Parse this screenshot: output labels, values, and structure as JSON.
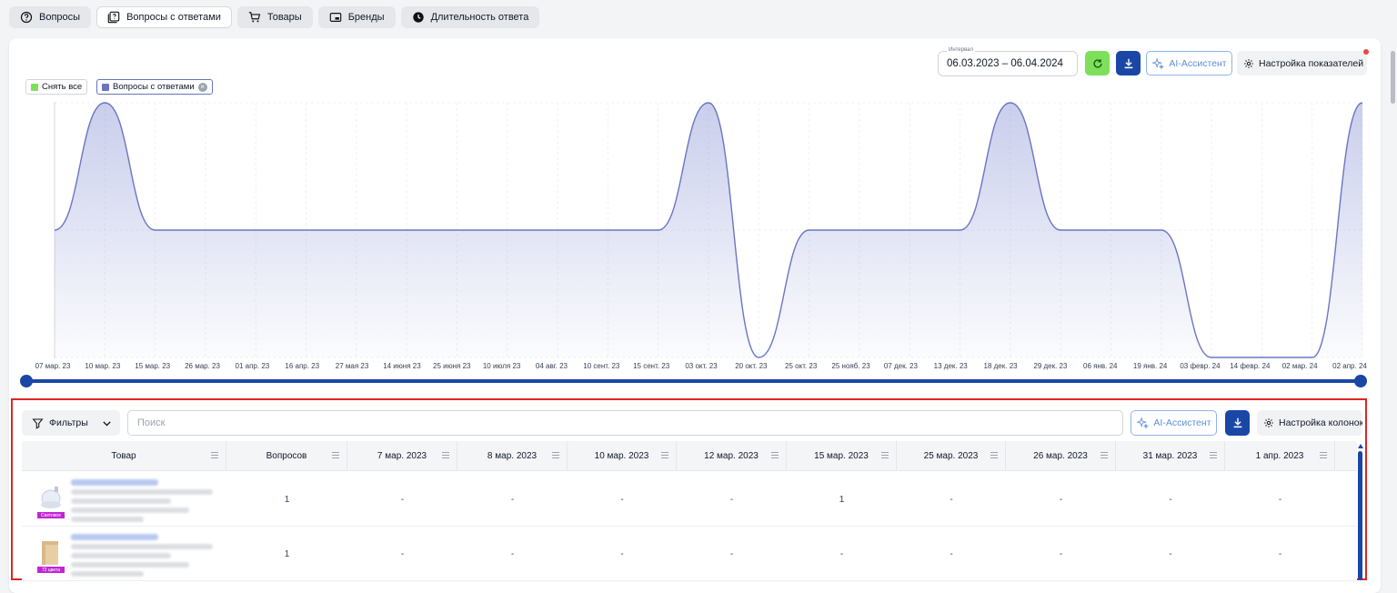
{
  "tabs": [
    {
      "label": "Вопросы",
      "icon": "question-circle-icon"
    },
    {
      "label": "Вопросы с ответами",
      "icon": "question-answer-icon",
      "active": true
    },
    {
      "label": "Товары",
      "icon": "cart-icon"
    },
    {
      "label": "Бренды",
      "icon": "brand-card-icon"
    },
    {
      "label": "Длительность ответа",
      "icon": "clock-icon"
    }
  ],
  "toolbar": {
    "interval_label": "Интервал",
    "interval_value": "06.03.2023 – 06.04.2024",
    "ai_label": "AI-Ассистент",
    "settings_label": "Настройка показателей"
  },
  "legend": {
    "clear_all": "Снять все",
    "series_chip": "Вопросы с ответами"
  },
  "colors": {
    "accent": "#1a47a6",
    "line": "#6a76c2",
    "refresh": "#7ee05a",
    "highlight": "#dc2626",
    "clear_swatch": "#7ee05a"
  },
  "chart_data": {
    "type": "area",
    "x": [
      "07 мар. 23",
      "10 мар. 23",
      "15 мар. 23",
      "26 мар. 23",
      "01 апр. 23",
      "16 апр. 23",
      "27 мая 23",
      "14 июня 23",
      "25 июня 23",
      "10 июля 23",
      "04 авг. 23",
      "10 сент. 23",
      "15 сент. 23",
      "03 окт. 23",
      "20 окт. 23",
      "25 окт. 23",
      "25 нояб. 23",
      "07 дек. 23",
      "13 дек. 23",
      "18 дек. 23",
      "29 дек. 23",
      "06 янв. 24",
      "19 янв. 24",
      "03 февр. 24",
      "14 февр. 24",
      "02 мар. 24",
      "02 апр. 24"
    ],
    "series": [
      {
        "name": "Вопросы с ответами",
        "values": [
          1,
          2,
          1,
          1,
          1,
          1,
          1,
          1,
          1,
          1,
          1,
          1,
          1,
          2,
          0,
          1,
          1,
          1,
          1,
          2,
          1,
          1,
          1,
          0,
          0,
          0,
          2
        ]
      }
    ],
    "ylim": [
      0,
      2
    ],
    "grid": true
  },
  "table": {
    "filters_label": "Фильтры",
    "search_placeholder": "Поиск",
    "ai_label": "AI-Ассистент",
    "columns_settings_label": "Настройка колонок",
    "headers": [
      "Товар",
      "Вопросов",
      "7 мар. 2023",
      "8 мар. 2023",
      "10 мар. 2023",
      "12 мар. 2023",
      "15 мар. 2023",
      "25 мар. 2023",
      "26 мар. 2023",
      "31 мар. 2023",
      "1 апр. 2023"
    ],
    "rows": [
      {
        "thumb_label": "Световое",
        "values": [
          "1",
          "-",
          "-",
          "-",
          "-",
          "1",
          "-",
          "-",
          "-",
          "-"
        ]
      },
      {
        "thumb_label": "72 цвета",
        "values": [
          "1",
          "-",
          "-",
          "-",
          "-",
          "-",
          "-",
          "-",
          "-",
          "-"
        ]
      }
    ]
  }
}
